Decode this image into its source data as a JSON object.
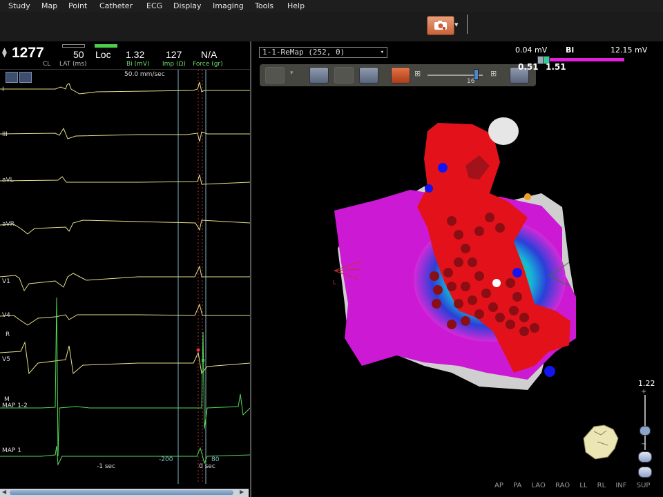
{
  "menu": [
    "Study",
    "Map",
    "Point",
    "Catheter",
    "ECG",
    "Display",
    "Imaging",
    "Tools",
    "Help"
  ],
  "header": {
    "cl_value": "1277",
    "cl_label": "CL",
    "lat_value": "50",
    "lat_label": "LAT (ms)",
    "loc_value": "Loc",
    "bi_value": "1.32",
    "bi_label": "Bi (mV)",
    "imp_value": "127",
    "imp_label": "Imp (Ω)",
    "force_value": "N/A",
    "force_label": "Force (gr)"
  },
  "ecg": {
    "speed": "50.0 mm/sec",
    "channels": [
      "I",
      "III",
      "aVL",
      "aVR",
      "V1",
      "V4",
      "V5",
      "MAP 1-2",
      "MAP 1"
    ],
    "marker_r": "R",
    "marker_m": "M",
    "window_left": "-200",
    "window_right": "80",
    "time_left": "-1 sec",
    "time_right": "0 sec"
  },
  "map": {
    "selector": "1-1-ReMap (252, 0)",
    "slider_value": "16",
    "bi_min": "0.04 mV",
    "bi_mode": "Bi",
    "bi_max": "12.15 mV",
    "bi_low_threshold": "0.51",
    "bi_high_threshold": "1.51",
    "zoom": "1.22",
    "orientation_label": "L",
    "views": [
      "AP",
      "PA",
      "LAO",
      "RAO",
      "LL",
      "RL",
      "INF",
      "SUP"
    ]
  },
  "colors": {
    "ecg_trace": "#e8e08a",
    "map_trace": "#57d957",
    "window_line": "#7fb6c4",
    "bi_bar": "#e021d7"
  }
}
